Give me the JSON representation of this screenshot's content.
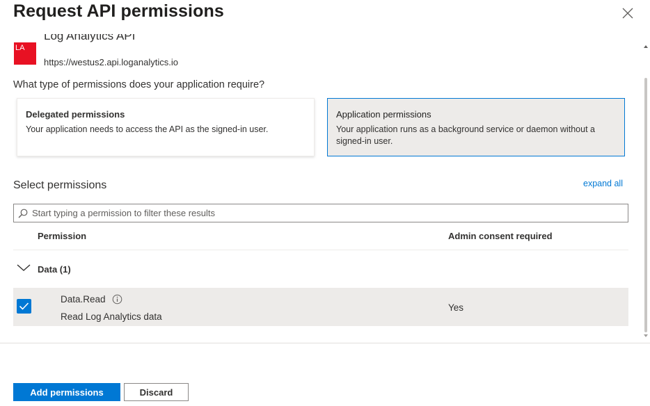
{
  "panel": {
    "title": "Request API permissions"
  },
  "api": {
    "logo_text": "LA",
    "logo_color": "#e81123",
    "name": "Log Analytics API",
    "url": "https://westus2.api.loganalytics.io"
  },
  "question": "What type of permissions does your application require?",
  "permission_types": {
    "delegated": {
      "title": "Delegated permissions",
      "description": "Your application needs to access the API as the signed-in user."
    },
    "application": {
      "title": "Application permissions",
      "description": "Your application runs as a background service or daemon without a signed-in user.",
      "selected": true
    }
  },
  "select_permissions": {
    "label": "Select permissions",
    "expand_all": "expand all",
    "search_placeholder": "Start typing a permission to filter these results",
    "search_value": ""
  },
  "table": {
    "columns": {
      "permission": "Permission",
      "admin_consent": "Admin consent required"
    },
    "groups": [
      {
        "label": "Data (1)",
        "expanded": true,
        "items": [
          {
            "name": "Data.Read",
            "description": "Read Log Analytics data",
            "admin_consent": "Yes",
            "checked": true
          }
        ]
      }
    ]
  },
  "footer": {
    "add_label": "Add permissions",
    "discard_label": "Discard"
  },
  "colors": {
    "accent": "#0078d4",
    "selected_bg": "#edebe9",
    "text": "#323130"
  },
  "icons": {
    "close": "close-icon",
    "search": "search-icon",
    "chevron": "chevron-down-icon",
    "info": "info-icon",
    "check": "checkmark-icon"
  }
}
